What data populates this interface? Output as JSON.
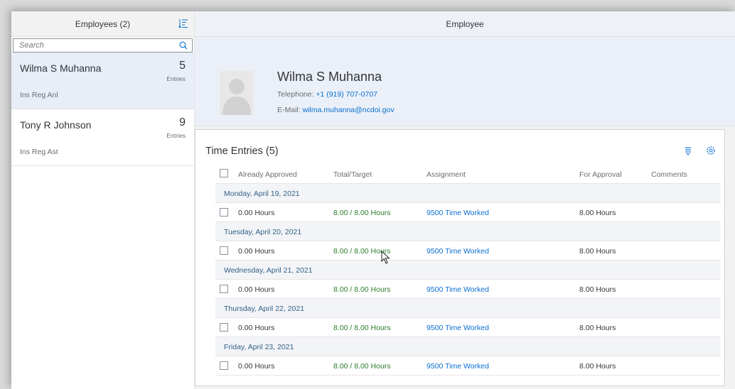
{
  "master": {
    "title": "Employees (2)",
    "search_placeholder": "Search",
    "employees": [
      {
        "name": "Wilma S Muhanna",
        "title": "Ins Reg Anl",
        "count": "5",
        "unit": "Entries"
      },
      {
        "name": "Tony R Johnson",
        "title": "Ins Reg Ast",
        "count": "9",
        "unit": "Entries"
      }
    ]
  },
  "detail": {
    "title": "Employee",
    "name": "Wilma S Muhanna",
    "phone_label": "Telephone:",
    "phone": "+1 (919) 707-0707",
    "email_label": "E-Mail:",
    "email": "wilma.muhanna@ncdoi.gov"
  },
  "entries": {
    "title": "Time Entries (5)",
    "columns": [
      "Already Approved",
      "Total/Target",
      "Assignment",
      "For Approval",
      "Comments"
    ],
    "groups": [
      {
        "date": "Monday, April 19, 2021",
        "approved": "0.00 Hours",
        "total": "8.00 / 8.00 Hours",
        "assignment": "9500 Time Worked",
        "for_approval": "8.00 Hours",
        "comments": ""
      },
      {
        "date": "Tuesday, April 20, 2021",
        "approved": "0.00 Hours",
        "total": "8.00 / 8.00 Hours",
        "assignment": "9500 Time Worked",
        "for_approval": "8.00 Hours",
        "comments": ""
      },
      {
        "date": "Wednesday, April 21, 2021",
        "approved": "0.00 Hours",
        "total": "8.00 / 8.00 Hours",
        "assignment": "9500 Time Worked",
        "for_approval": "8.00 Hours",
        "comments": ""
      },
      {
        "date": "Thursday, April 22, 2021",
        "approved": "0.00 Hours",
        "total": "8.00 / 8.00 Hours",
        "assignment": "9500 Time Worked",
        "for_approval": "8.00 Hours",
        "comments": ""
      },
      {
        "date": "Friday, April 23, 2021",
        "approved": "0.00 Hours",
        "total": "8.00 / 8.00 Hours",
        "assignment": "9500 Time Worked",
        "for_approval": "8.00 Hours",
        "comments": ""
      }
    ]
  },
  "icons": {
    "sort": "sort-icon",
    "search": "search-icon",
    "group_by": "group-by-icon",
    "settings": "settings-gear-icon",
    "avatar": "person-placeholder-icon",
    "cursor": "mouse-pointer-icon"
  },
  "colors": {
    "accent": "#0a6ed1",
    "success": "#2b7d2b",
    "selected": "#e8edf7",
    "group_text": "#346187"
  }
}
